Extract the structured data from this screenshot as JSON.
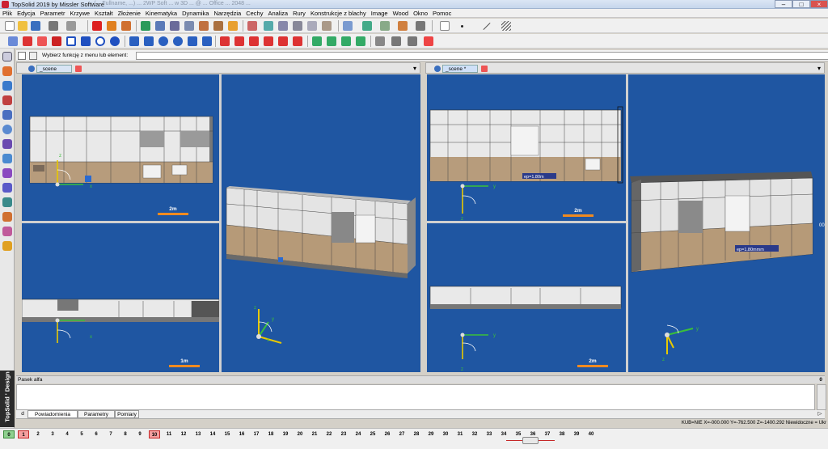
{
  "window": {
    "title": "TopSolid 2019 by Missler Software",
    "title_detail": "- (... Fullname, ...) ... 2WP Soft ... w 3D ... @ ... Office ... 2048 ..."
  },
  "menu": [
    "Plik",
    "Edycja",
    "Parametr",
    "Krzywe",
    "Kształt",
    "Złożenie",
    "Kinematyka",
    "Dynamika",
    "Narzędzia",
    "Cechy",
    "Analiza",
    "Rury",
    "Konstrukcje z blachy",
    "Image",
    "Wood",
    "Okno",
    "Pomoc"
  ],
  "command": {
    "prompt": "Wybierz funkcję z menu lub element:",
    "value": ""
  },
  "documents": [
    {
      "tab": "_scene"
    },
    {
      "tab": "_scene *"
    }
  ],
  "viewports": {
    "left_top_scale": "2m",
    "left_bottom_scale": "1m",
    "right_top_scale": "2m",
    "right_bottom_scale": "2m",
    "dim_label_1": "ep=1.80m",
    "dim_label_2": "ep=1.80mmm",
    "edge_label": "00"
  },
  "axes": {
    "x": "x",
    "y": "y",
    "z": "z"
  },
  "bottom": {
    "pane_title": "Pasek alfa",
    "pane_count": "0",
    "tabs": [
      "Powiadomienia",
      "Parametry",
      "Pomiary"
    ],
    "tab_prev": "d",
    "tab_next": "▷"
  },
  "status": "KUB=NIE X=-000.000   Y=-762.500   Z=-1400.292 Niewidoczne = Ukr",
  "brand": "TopSolid ' Design",
  "pages": [
    "0",
    "1",
    "2",
    "3",
    "4",
    "5",
    "6",
    "7",
    "8",
    "9",
    "10",
    "11",
    "12",
    "13",
    "14",
    "15",
    "16",
    "17",
    "18",
    "19",
    "20",
    "21",
    "22",
    "23",
    "24",
    "25",
    "26",
    "27",
    "28",
    "29",
    "30",
    "31",
    "32",
    "33",
    "34",
    "35",
    "36",
    "37",
    "38",
    "39",
    "40"
  ],
  "colors": {
    "viewport": "#1f56a2",
    "scale": "#f08a20",
    "accent": "#c62828"
  }
}
